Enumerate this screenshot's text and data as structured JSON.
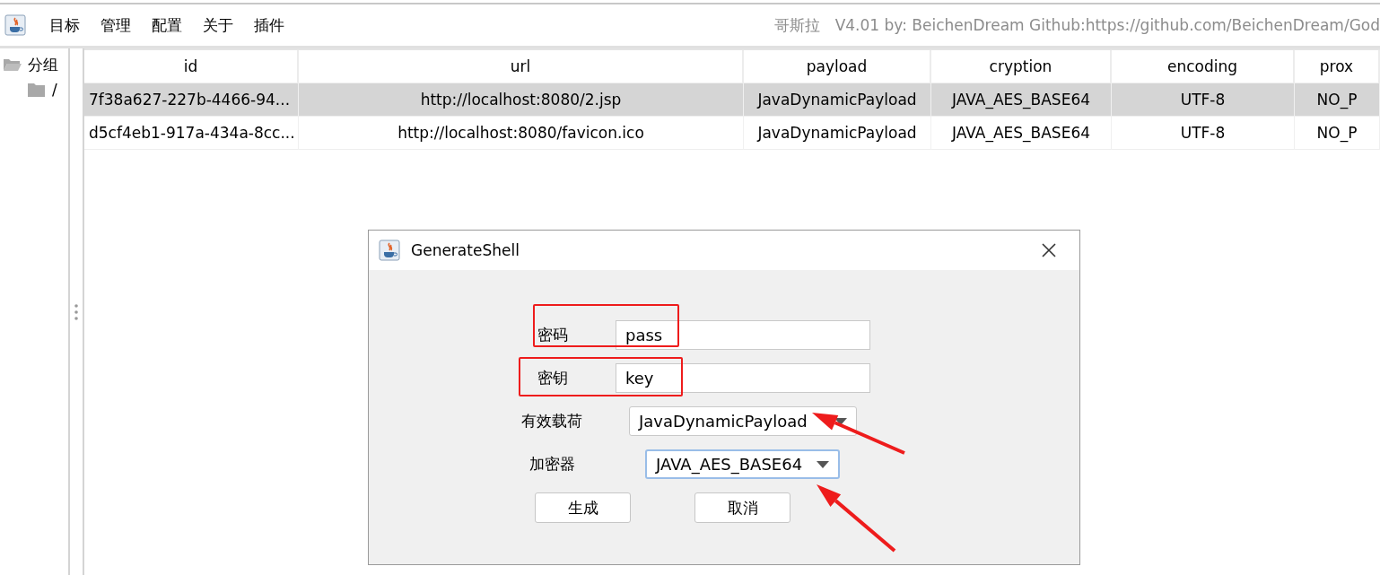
{
  "menu_bar": {
    "items": [
      "目标",
      "管理",
      "配置",
      "关于",
      "插件"
    ],
    "title": "哥斯拉   V4.01 by: BeichenDream Github:https://github.com/BeichenDream/God"
  },
  "sidebar": {
    "tree": [
      {
        "label": "分组",
        "expanded": true,
        "children": [
          {
            "label": "/",
            "expanded": false
          }
        ]
      }
    ]
  },
  "table": {
    "columns": [
      "id",
      "url",
      "payload",
      "cryption",
      "encoding",
      "prox"
    ],
    "rows": [
      {
        "selected": true,
        "cells": [
          "7f38a627-227b-4466-94...",
          "http://localhost:8080/2.jsp",
          "JavaDynamicPayload",
          "JAVA_AES_BASE64",
          "UTF-8",
          "NO_P"
        ]
      },
      {
        "selected": false,
        "cells": [
          "d5cf4eb1-917a-434a-8cc...",
          "http://localhost:8080/favicon.ico",
          "JavaDynamicPayload",
          "JAVA_AES_BASE64",
          "UTF-8",
          "NO_P"
        ]
      }
    ]
  },
  "dialog": {
    "title": "GenerateShell",
    "fields": [
      {
        "kind": "text",
        "label": "密码",
        "value": "pass"
      },
      {
        "kind": "text",
        "label": "密钥",
        "value": "key"
      },
      {
        "kind": "combo",
        "label": "有效载荷",
        "value": "JavaDynamicPayload",
        "focused": false
      },
      {
        "kind": "combo",
        "label": "加密器",
        "value": "JAVA_AES_BASE64",
        "focused": true
      }
    ],
    "buttons": [
      "生成",
      "取消"
    ]
  },
  "annotations": [
    {
      "kind": "box"
    },
    {
      "kind": "box"
    },
    {
      "kind": "arrow"
    },
    {
      "kind": "arrow"
    }
  ]
}
